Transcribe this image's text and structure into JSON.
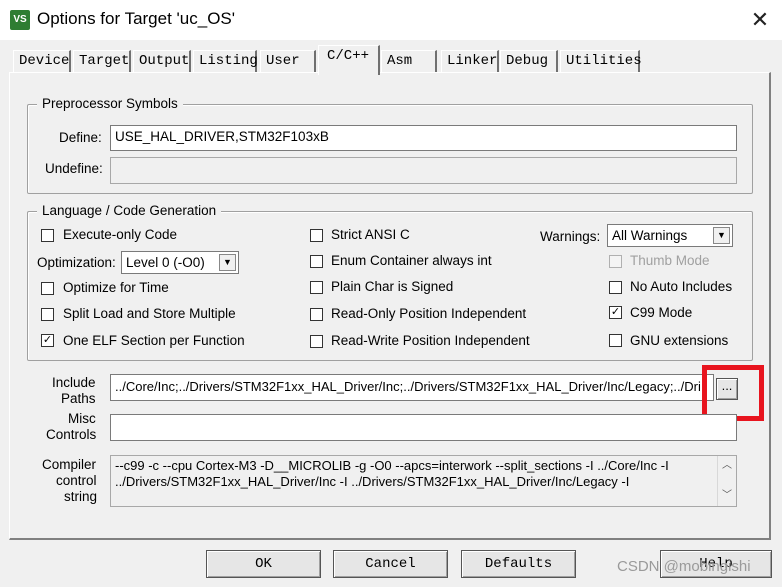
{
  "window": {
    "title": "Options for Target 'uc_OS'",
    "app_icon_text": "VS",
    "close": "✕"
  },
  "tabs": [
    "Device",
    "Target",
    "Output",
    "Listing",
    "User",
    "C/C++",
    "Asm",
    "Linker",
    "Debug",
    "Utilities"
  ],
  "active_tab": "C/C++",
  "preprocessor": {
    "title": "Preprocessor Symbols",
    "define_label": "Define:",
    "define_value": "USE_HAL_DRIVER,STM32F103xB",
    "undefine_label": "Undefine:",
    "undefine_value": ""
  },
  "langgen": {
    "title": "Language / Code Generation",
    "execute_only": {
      "label": "Execute-only Code",
      "checked": false
    },
    "optimization_label": "Optimization:",
    "optimization_value": "Level 0 (-O0)",
    "optimize_time": {
      "label": "Optimize for Time",
      "checked": false
    },
    "split_load": {
      "label": "Split Load and Store Multiple",
      "checked": false
    },
    "one_elf": {
      "label": "One ELF Section per Function",
      "checked": true
    },
    "strict_ansi": {
      "label": "Strict ANSI C",
      "checked": false
    },
    "enum_container": {
      "label": "Enum Container always int",
      "checked": false
    },
    "plain_char": {
      "label": "Plain Char is Signed",
      "checked": false
    },
    "ropi": {
      "label": "Read-Only Position Independent",
      "checked": false
    },
    "rwpi": {
      "label": "Read-Write Position Independent",
      "checked": false
    },
    "warnings_label": "Warnings:",
    "warnings_value": "All Warnings",
    "thumb_mode": {
      "label": "Thumb Mode",
      "checked": false,
      "disabled": true
    },
    "no_auto_includes": {
      "label": "No Auto Includes",
      "checked": false
    },
    "c99_mode": {
      "label": "C99 Mode",
      "checked": true
    },
    "gnu_ext": {
      "label": "GNU extensions",
      "checked": false
    }
  },
  "include": {
    "label_line1": "Include",
    "label_line2": "Paths",
    "value": "../Core/Inc;../Drivers/STM32F1xx_HAL_Driver/Inc;../Drivers/STM32F1xx_HAL_Driver/Inc/Legacy;../Dri",
    "browse": "..."
  },
  "misc": {
    "label_line1": "Misc",
    "label_line2": "Controls",
    "value": ""
  },
  "compiler": {
    "label_line1": "Compiler",
    "label_line2": "control",
    "label_line3": "string",
    "line1": "--c99 -c --cpu Cortex-M3 -D__MICROLIB -g -O0 --apcs=interwork --split_sections -I ../Core/Inc -I",
    "line2": "../Drivers/STM32F1xx_HAL_Driver/Inc -I ../Drivers/STM32F1xx_HAL_Driver/Inc/Legacy -I"
  },
  "buttons": {
    "ok": "OK",
    "cancel": "Cancel",
    "defaults": "Defaults",
    "help": "Help"
  },
  "watermark": "CSDN @mobingishi",
  "colors": {
    "highlight_box": "#e8141e",
    "checked_color": "#000000"
  }
}
